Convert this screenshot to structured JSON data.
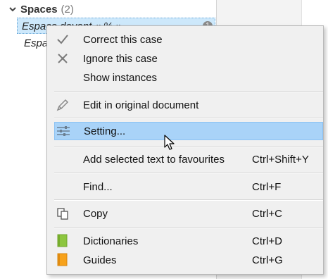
{
  "tree": {
    "group": {
      "title": "Spaces",
      "count": "(2)"
    },
    "items": [
      {
        "label": "Espace devant « % »",
        "badge": "1"
      },
      {
        "label": "Espace"
      }
    ]
  },
  "context_menu": {
    "items": [
      {
        "label": "Correct this case",
        "icon": "checkmark-icon"
      },
      {
        "label": "Ignore this case",
        "icon": "x-icon"
      },
      {
        "label": "Show instances"
      },
      {
        "label": "Edit in original document",
        "icon": "pencil-icon"
      },
      {
        "label": "Setting...",
        "icon": "sliders-icon",
        "highlighted": true
      },
      {
        "label": "Add selected text to favourites",
        "shortcut": "Ctrl+Shift+Y"
      },
      {
        "label": "Find...",
        "shortcut": "Ctrl+F"
      },
      {
        "label": "Copy",
        "shortcut": "Ctrl+C",
        "icon": "copy-icon"
      },
      {
        "label": "Dictionaries",
        "shortcut": "Ctrl+D",
        "icon": "green-book-icon"
      },
      {
        "label": "Guides",
        "shortcut": "Ctrl+G",
        "icon": "orange-book-icon"
      }
    ]
  },
  "colors": {
    "menu_bg": "#f0f0f0",
    "highlight": "#a9d3f8",
    "selected_row": "#cde8fb",
    "dictionaries_icon": "#8dc63f",
    "guides_icon": "#f7a21b"
  }
}
